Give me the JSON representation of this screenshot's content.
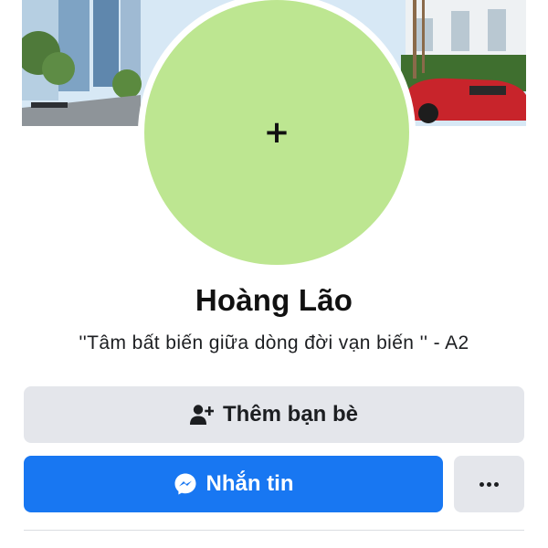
{
  "profile": {
    "avatar_icon": "plus-icon",
    "avatar_color": "#bde691",
    "avatar_symbol": "+",
    "name": "Hoàng Lão",
    "bio": "''Tâm bất biến giữa dòng đời vạn biến '' - A2"
  },
  "actions": {
    "add_friend_label": "Thêm bạn bè",
    "add_friend_icon": "add-friend-icon",
    "message_label": "Nhắn tin",
    "message_icon": "messenger-icon",
    "more_icon": "more-options-icon"
  },
  "colors": {
    "primary": "#1877f2",
    "secondary_button": "#e4e6eb",
    "text": "#1c1e21"
  }
}
